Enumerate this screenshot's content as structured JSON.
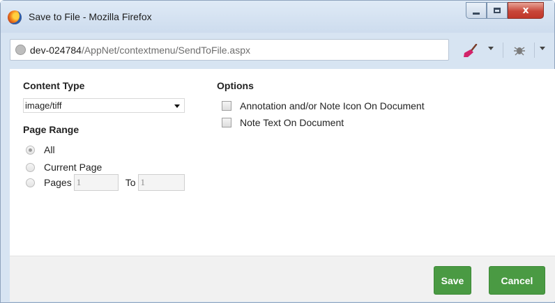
{
  "window": {
    "title": "Save to File - Mozilla Firefox",
    "controls": {
      "minimize": "minimize",
      "maximize": "maximize",
      "close": "x"
    }
  },
  "address_bar": {
    "host": "dev-024784",
    "path": "/AppNet/contextmenu/SendToFile.aspx"
  },
  "toolbar": {
    "icons": [
      "broom-icon",
      "dropdown-arrow-icon",
      "bug-icon",
      "dropdown-arrow-icon"
    ]
  },
  "content_type": {
    "label": "Content Type",
    "selected": "image/tiff"
  },
  "page_range": {
    "label": "Page Range",
    "selected": "All",
    "options": [
      "All",
      "Current Page",
      "Pages"
    ],
    "to_label": "To",
    "from_value": "1",
    "to_value": "1"
  },
  "options": {
    "label": "Options",
    "items": [
      {
        "label": "Annotation and/or Note Icon On Document",
        "checked": false
      },
      {
        "label": "Note Text On Document",
        "checked": false
      }
    ]
  },
  "buttons": {
    "save": "Save",
    "cancel": "Cancel"
  },
  "colors": {
    "primary_button": "#4a9a43",
    "title_bar": "#d7e4f2",
    "close_button": "#c8473a"
  }
}
